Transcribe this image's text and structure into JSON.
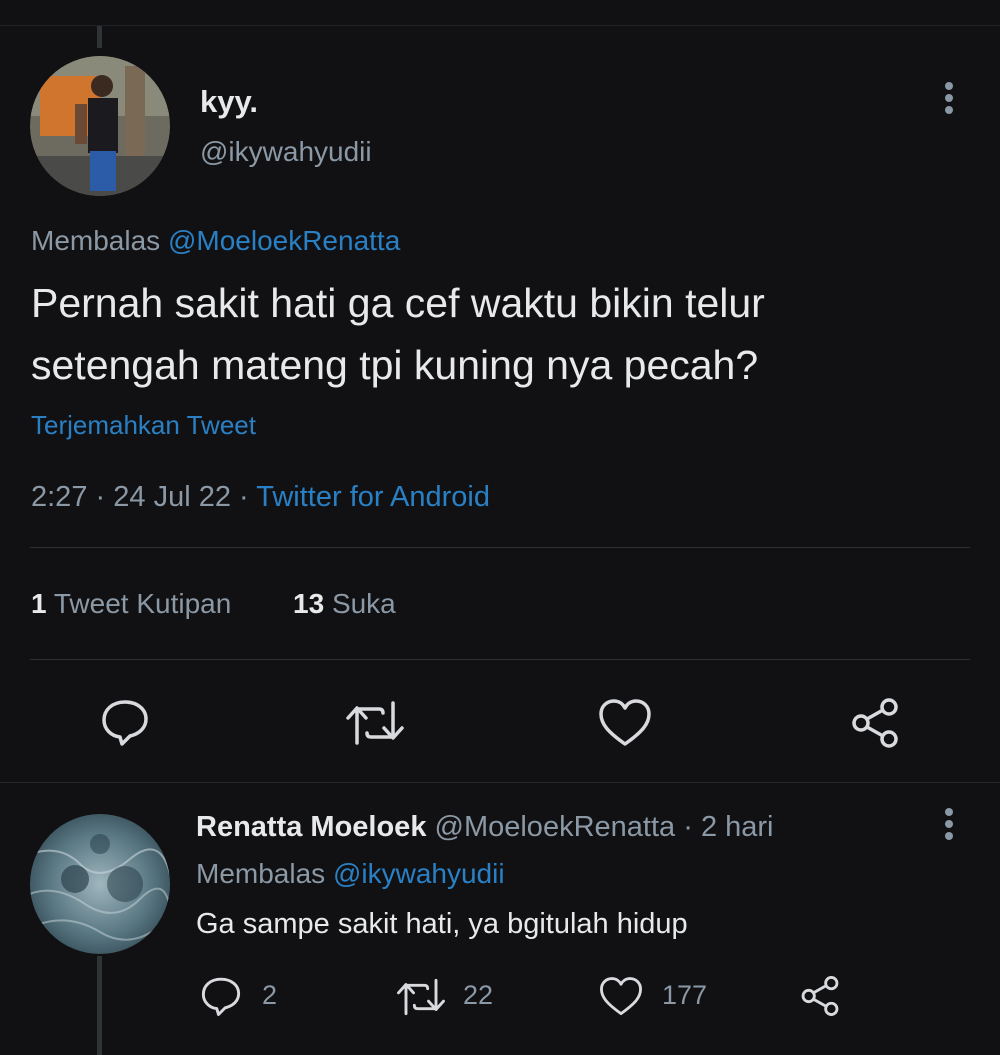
{
  "tweet": {
    "name": "kyy.",
    "handle": "@ikywahyudii",
    "reply_prefix": "Membalas",
    "reply_to": "@MoeloekRenatta",
    "text_line1": "Pernah sakit hati ga cef waktu bikin telur",
    "text_line2": "setengah mateng tpi kuning nya pecah?",
    "translate": "Terjemahkan Tweet",
    "time": "2:27",
    "sep1": "·",
    "date": "24 Jul 22",
    "sep2": "·",
    "source": "Twitter for Android",
    "quote_count": "1",
    "quote_label": "Tweet Kutipan",
    "like_count": "13",
    "like_label": "Suka"
  },
  "reply": {
    "name": "Renatta Moeloek",
    "handle": "@MoeloekRenatta",
    "sep": "·",
    "age": "2 hari",
    "reply_prefix": "Membalas",
    "reply_to": "@ikywahyudii",
    "text": "Ga sampe sakit hati, ya bgitulah hidup",
    "reply_count": "2",
    "retweet_count": "22",
    "like_count": "177"
  },
  "icons": [
    "more-icon",
    "reply-icon",
    "retweet-icon",
    "like-icon",
    "share-icon"
  ],
  "colors": {
    "background": "#111113",
    "text": "#e7e9ea",
    "muted": "#8b98a5",
    "link": "#2a80c4"
  }
}
